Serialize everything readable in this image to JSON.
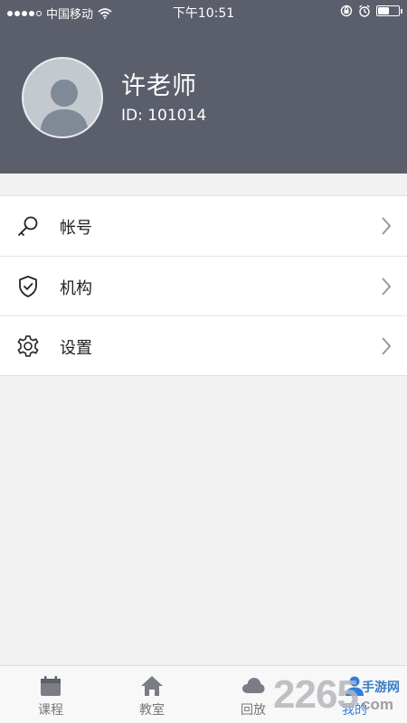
{
  "status_bar": {
    "carrier": "中国移动",
    "time": "下午10:51"
  },
  "profile": {
    "name": "许老师",
    "id_text": "ID: 101014"
  },
  "menu": {
    "items": [
      {
        "label": "帐号",
        "icon": "key-icon"
      },
      {
        "label": "机构",
        "icon": "shield-check-icon"
      },
      {
        "label": "设置",
        "icon": "gear-icon"
      }
    ]
  },
  "tabbar": {
    "tabs": [
      {
        "label": "课程",
        "icon": "calendar-icon",
        "active": false
      },
      {
        "label": "教室",
        "icon": "home-icon",
        "active": false
      },
      {
        "label": "回放",
        "icon": "cloud-icon",
        "active": false
      },
      {
        "label": "我的",
        "icon": "person-icon",
        "active": true
      }
    ]
  },
  "watermark": {
    "number": "2265",
    "text_top": "手游网",
    "text_bottom": "com"
  },
  "colors": {
    "header_bg": "#5b5e6b",
    "accent": "#2f7fdc",
    "page_bg": "#f2f2f2"
  }
}
